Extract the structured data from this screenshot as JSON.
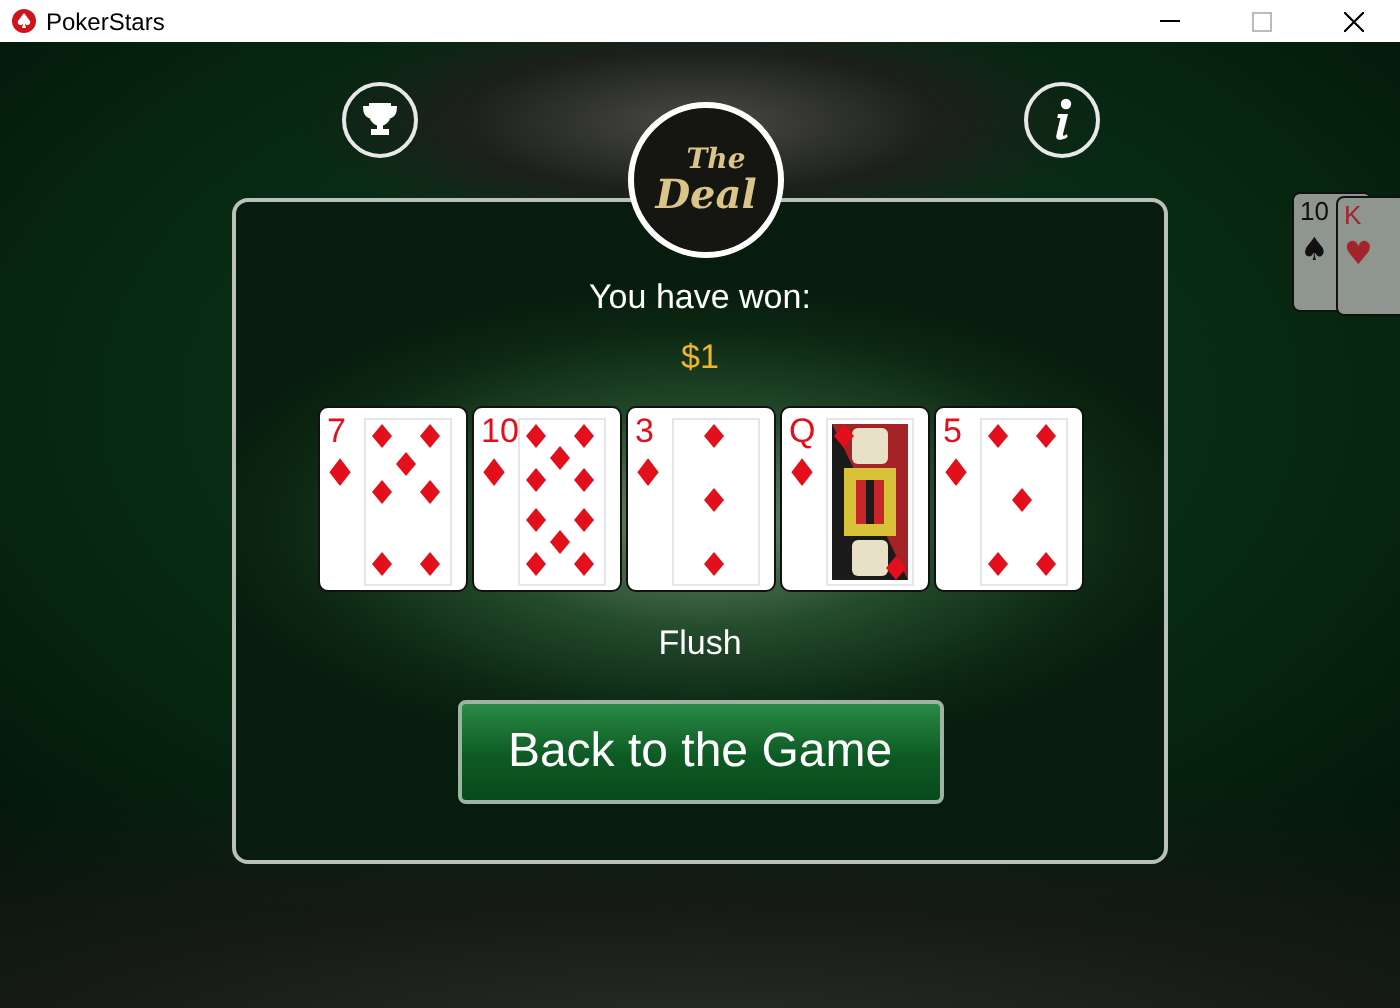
{
  "window": {
    "title": "PokerStars"
  },
  "logo": {
    "top": "The",
    "bottom": "Deal"
  },
  "background_cards": [
    {
      "rank": "10",
      "suit": "♠",
      "color": "#111111"
    },
    {
      "rank": "K",
      "suit": "♥",
      "color": "#a3242a"
    }
  ],
  "result": {
    "heading": "You have won:",
    "amount": "$1",
    "hand_name": "Flush"
  },
  "cards": [
    {
      "rank": "7",
      "suit": "♦",
      "color": "#e3101c",
      "kind": "number"
    },
    {
      "rank": "10",
      "suit": "♦",
      "color": "#e3101c",
      "kind": "number"
    },
    {
      "rank": "3",
      "suit": "♦",
      "color": "#e3101c",
      "kind": "number"
    },
    {
      "rank": "Q",
      "suit": "♦",
      "color": "#e3101c",
      "kind": "face"
    },
    {
      "rank": "5",
      "suit": "♦",
      "color": "#e3101c",
      "kind": "number"
    }
  ],
  "button": {
    "label": "Back to the Game"
  }
}
